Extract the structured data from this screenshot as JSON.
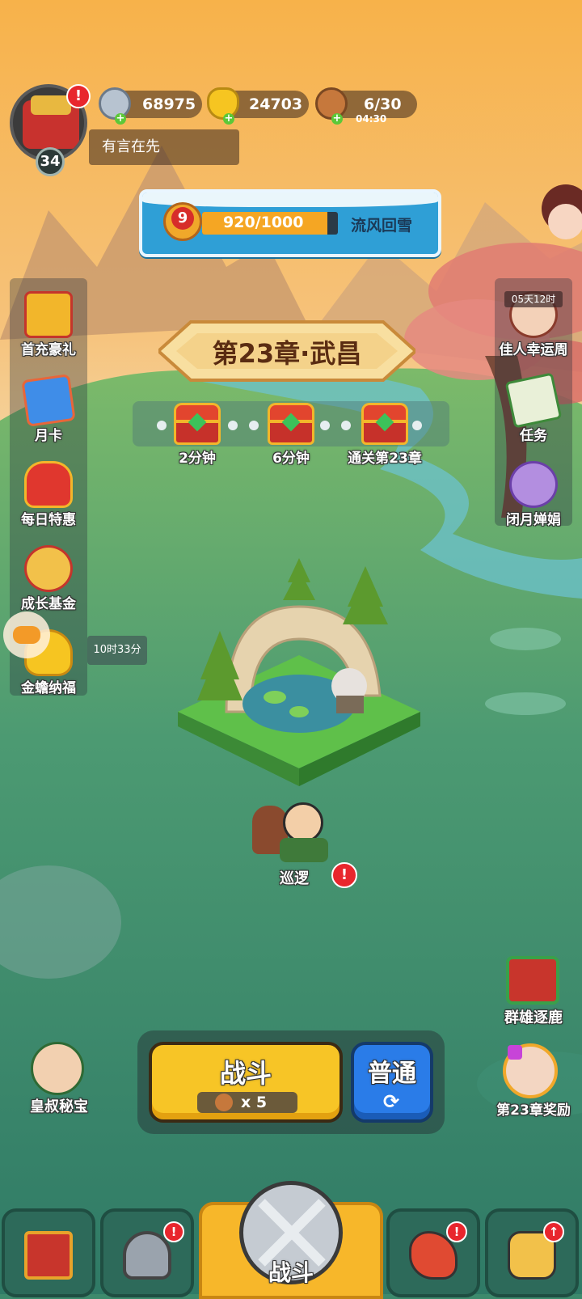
{
  "player": {
    "level": "34",
    "name": "有言在先"
  },
  "currencies": {
    "silver": {
      "value": "68975",
      "icon": "silver-coin-icon"
    },
    "gold": {
      "value": "24703",
      "icon": "gold-ingot-icon"
    },
    "stamina": {
      "value": "6/30",
      "timer": "04:30",
      "icon": "meat-icon"
    }
  },
  "progress": {
    "rank": "9",
    "value": "920/1000",
    "fraction": 0.92,
    "stage_name": "流风回雪"
  },
  "chapter": {
    "title": "第23章·武昌"
  },
  "chest_rewards": [
    {
      "label": "2分钟"
    },
    {
      "label": "6分钟"
    },
    {
      "label": "通关第23章"
    }
  ],
  "left_menu": [
    {
      "label": "首充豪礼",
      "icon": "treasure-chest-icon"
    },
    {
      "label": "月卡",
      "icon": "monthly-card-icon"
    },
    {
      "label": "每日特惠",
      "icon": "gift-bag-icon"
    },
    {
      "label": "成长基金",
      "icon": "monkey-fund-icon"
    },
    {
      "label": "金蟾纳福",
      "icon": "golden-toad-icon",
      "timer": "10时33分"
    }
  ],
  "right_menu": [
    {
      "label": "佳人幸运周",
      "icon": "beauty-portrait-icon",
      "timer": "05天12时"
    },
    {
      "label": "任务",
      "icon": "scroll-icon"
    },
    {
      "label": "闭月婵娟",
      "icon": "moon-lady-icon"
    }
  ],
  "patrol": {
    "label": "巡逻"
  },
  "bottom_left": {
    "label": "皇叔秘宝"
  },
  "bottom_right": [
    {
      "label": "群雄逐鹿"
    },
    {
      "label": "第23章奖励"
    }
  ],
  "battle": {
    "label": "战斗",
    "cost": "x 5"
  },
  "mode": {
    "label": "普通"
  },
  "bottom_nav": {
    "center_label": "战斗"
  },
  "colors": {
    "battle_yellow": "#f7c526",
    "mode_blue": "#2a7ce8",
    "progress_orange": "#f5a623",
    "badge_red": "#e8262d"
  }
}
